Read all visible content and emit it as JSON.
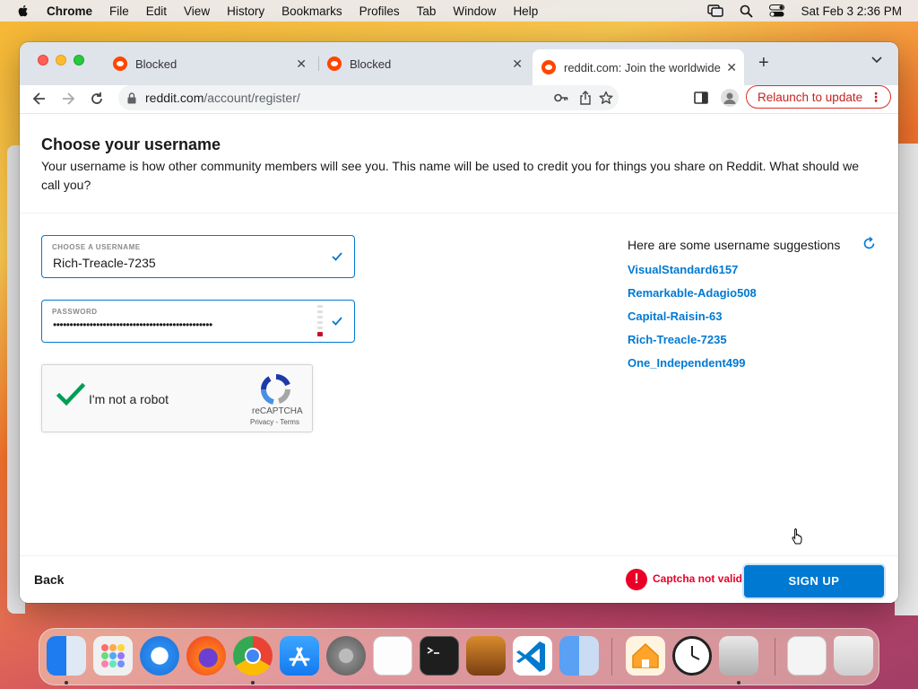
{
  "menubar": {
    "app": "Chrome",
    "items": [
      "File",
      "Edit",
      "View",
      "History",
      "Bookmarks",
      "Profiles",
      "Tab",
      "Window",
      "Help"
    ],
    "clock": "Sat Feb 3  2:36 PM"
  },
  "tabs": [
    {
      "title": "Blocked"
    },
    {
      "title": "Blocked"
    },
    {
      "title": "reddit.com: Join the worldwide"
    }
  ],
  "address": {
    "host": "reddit.com",
    "path": "/account/register/"
  },
  "relaunch_label": "Relaunch to update",
  "page": {
    "heading": "Choose your username",
    "description": "Your username is how other community members will see you. This name will be used to credit you for things you share on Reddit. What should we call you?",
    "username": {
      "label": "CHOOSE A USERNAME",
      "value": "Rich-Treacle-7235"
    },
    "password": {
      "label": "PASSWORD",
      "value": "••••••••••••••••••••••••••••••••••••••••••••••••"
    },
    "captcha": {
      "text": "I'm not a robot",
      "brand": "reCAPTCHA",
      "links": "Privacy - Terms"
    },
    "suggestions_title": "Here are some username suggestions",
    "suggestions": [
      "VisualStandard6157",
      "Remarkable-Adagio508",
      "Capital-Raisin-63",
      "Rich-Treacle-7235",
      "One_Independent499"
    ],
    "back": "Back",
    "error": "Captcha not valid.",
    "signup": "SIGN UP"
  },
  "colors": {
    "accent": "#0079d3",
    "error": "#ea0027",
    "reddit": "#ff4500"
  },
  "dock_apps": [
    "finder-icon",
    "launchpad-icon",
    "safari-icon",
    "firefox-icon",
    "chrome-icon",
    "app-store-icon",
    "system-settings-icon",
    "textedit-icon",
    "terminal-icon",
    "garageband-icon",
    "vscode-icon",
    "preview-icon",
    "home-icon",
    "clock-icon",
    "disk-utility-icon",
    "screenshot-icon",
    "trash-icon"
  ]
}
